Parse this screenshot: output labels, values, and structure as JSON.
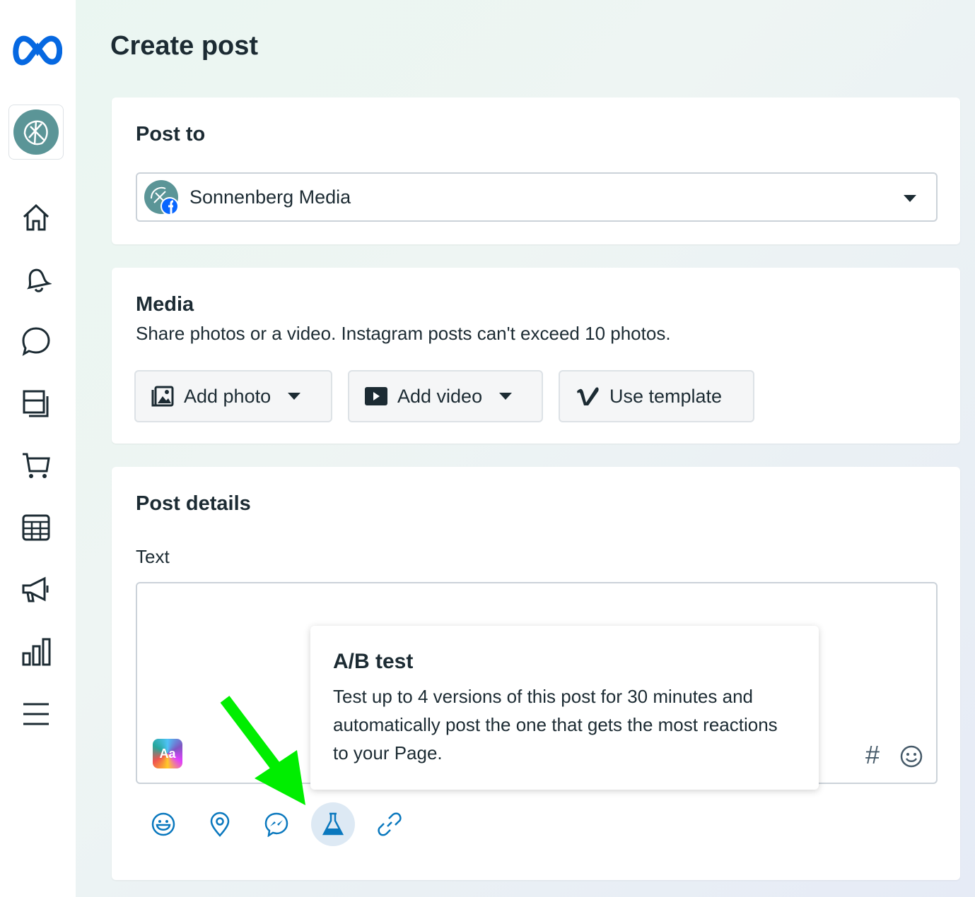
{
  "app": {
    "logo": "meta-logo",
    "page_title": "Create post"
  },
  "sidebar": {
    "items": [
      "home-icon",
      "bell-icon",
      "chat-icon",
      "pages-icon",
      "cart-icon",
      "calendar-icon",
      "megaphone-icon",
      "bar-chart-icon",
      "menu-icon"
    ]
  },
  "post_to": {
    "heading": "Post to",
    "selected": "Sonnenberg Media"
  },
  "media": {
    "heading": "Media",
    "description": "Share photos or a video. Instagram posts can't exceed 10 photos.",
    "buttons": {
      "add_photo": "Add photo",
      "add_video": "Add video",
      "use_template": "Use template"
    }
  },
  "details": {
    "heading": "Post details",
    "text_label": "Text",
    "text_value": "",
    "font_badge": "Aa",
    "hashtag": "#"
  },
  "tooltip": {
    "title": "A/B test",
    "body": "Test up to 4 versions of this post for 30 minutes and automatically post the one that gets the most reactions to your Page."
  },
  "toolbar": [
    "feeling-icon",
    "location-icon",
    "messenger-icon",
    "ab-test-icon",
    "link-icon"
  ],
  "colors": {
    "accent": "#0a78be",
    "meta_blue": "#0668e1",
    "avatar": "#5b9597",
    "arrow": "#00ee00"
  }
}
